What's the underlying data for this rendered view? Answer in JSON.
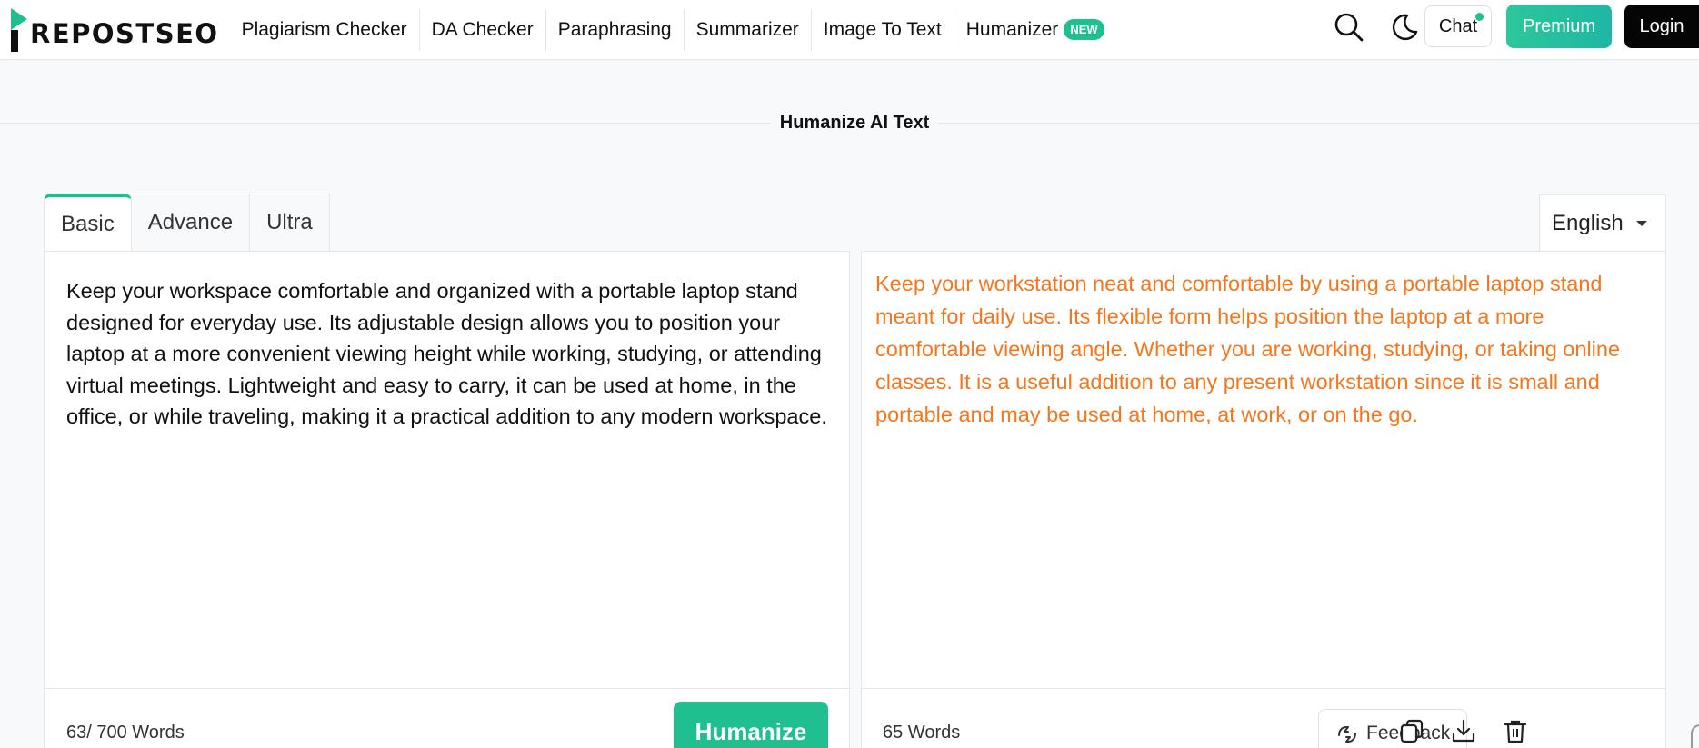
{
  "brand": {
    "logo_text": "REPOSTSEO",
    "accent_color": "#1fbf8f",
    "output_color": "#f4771e"
  },
  "nav": {
    "links": [
      {
        "label": "Plagiarism Checker"
      },
      {
        "label": "DA Checker"
      },
      {
        "label": "Paraphrasing"
      },
      {
        "label": "Summarizer"
      },
      {
        "label": "Image To Text"
      },
      {
        "label": "Humanizer",
        "badge": "NEW"
      }
    ],
    "icons": [
      "search-icon",
      "moon-icon"
    ],
    "chat_label": "Chat",
    "premium_label": "Premium",
    "login_label": "Login"
  },
  "page": {
    "title": "Humanize AI Text"
  },
  "tabs": [
    {
      "label": "Basic",
      "active": true
    },
    {
      "label": "Advance",
      "active": false
    },
    {
      "label": "Ultra",
      "active": false
    }
  ],
  "language": {
    "selected": "English"
  },
  "input": {
    "text": "Keep your workspace comfortable and organized with a portable laptop stand designed for everyday use. Its adjustable design allows you to position your laptop at a more convenient viewing height while working, studying, or attending virtual meetings. Lightweight and easy to carry, it can be used at home, in the office, or while traveling, making it a practical addition to any modern workspace.",
    "word_count": "63/ 700 Words",
    "humanize_label": "Humanize"
  },
  "output": {
    "text": "Keep your workstation neat and comfortable by using a portable laptop stand meant for daily use. Its flexible form helps position the laptop at a more comfortable viewing angle. Whether you are working, studying, or taking online classes. It is a useful addition to any present workstation since it is small and portable and may be used at home, at work, or on the go.",
    "word_count": "65 Words",
    "feedback_label": "Feedback",
    "tool_icons": [
      "copy-icon",
      "download-icon",
      "trash-icon"
    ]
  }
}
